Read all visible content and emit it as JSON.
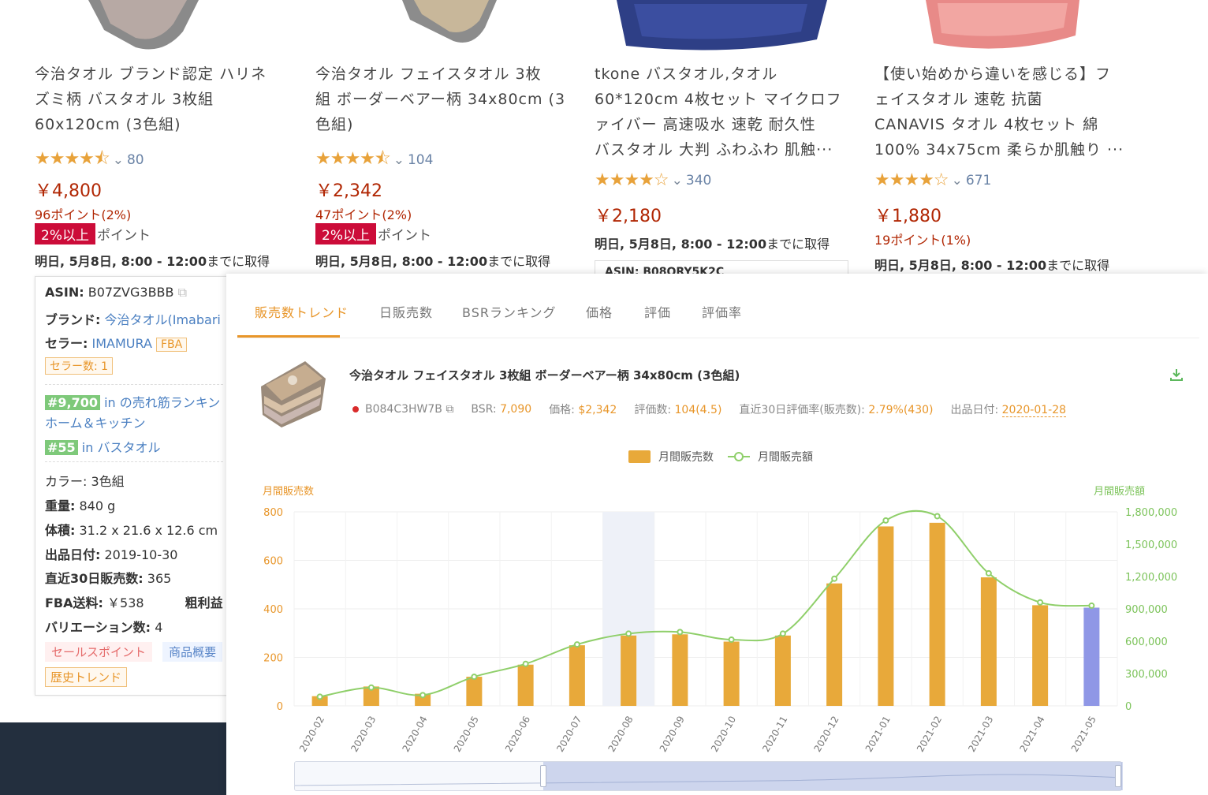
{
  "products": [
    {
      "title_lines": [
        "今治タオル ブランド認定 ハリネ",
        "ズミ柄 バスタオル 3枚組",
        "60x120cm (3色組)"
      ],
      "stars": "★★★★⯪",
      "rating_count": "80",
      "price": "￥4,800",
      "points": "96ポイント(2%)",
      "badge": "2%以上",
      "badge_suffix": "ポイント",
      "delivery_bold": "明日, 5月8日, 8:00 - 12:00",
      "delivery_rest": "までに取得"
    },
    {
      "title_lines": [
        "今治タオル フェイスタオル 3枚",
        "組 ボーダーベアー柄 34x80cm (3",
        "色組)"
      ],
      "stars": "★★★★⯪",
      "rating_count": "104",
      "price": "￥2,342",
      "points": "47ポイント(2%)",
      "badge": "2%以上",
      "badge_suffix": "ポイント",
      "delivery_bold": "明日, 5月8日, 8:00 - 12:00",
      "delivery_rest": "までに取得"
    },
    {
      "title_lines": [
        "tkone バスタオル,タオル",
        "60*120cm 4枚セット マイクロフ",
        "ァイバー 高速吸水 速乾 耐久性",
        "バスタオル 大判 ふわふわ 肌触···"
      ],
      "stars": "★★★★☆",
      "rating_count": "340",
      "price": "￥2,180",
      "delivery_bold": "明日, 5月8日, 8:00 - 12:00",
      "delivery_rest": "までに取得",
      "asin_partial": "ASIN: B08QRY5K2C"
    },
    {
      "title_lines": [
        "【使い始めから違いを感じる】フ",
        "ェイスタオル 速乾 抗菌",
        "CANAVIS タオル 4枚セット 綿",
        "100% 34x75cm 柔らか肌触り ···"
      ],
      "stars": "★★★★☆",
      "rating_count": "671",
      "price": "￥1,880",
      "points": "19ポイント(1%)",
      "delivery_bold": "明日, 5月8日, 8:00 - 12:00",
      "delivery_rest": "までに取得"
    }
  ],
  "info": {
    "asin_label": "ASIN:",
    "asin": "B07ZVG3BBB",
    "brand_label": "ブランド:",
    "brand": "今治タオル(Imabari",
    "seller_label": "セラー:",
    "seller": "IMAMURA",
    "seller_tag": "FBA",
    "seller_count": "セラー数: 1",
    "rank1": "#9,700",
    "rank1_text": "in の売れ筋ランキン",
    "rank1_cat": "ホーム＆キッチン",
    "rank2": "#55",
    "rank2_text": "in バスタオル",
    "color": "カラー: 3色組",
    "weight_label": "重量:",
    "weight": "840 g",
    "size_label": "体積:",
    "size": "31.2 x 21.6 x 12.6 cm",
    "listed_label": "出品日付:",
    "listed": "2019-10-30",
    "sales30_label": "直近30日販売数:",
    "sales30": "365",
    "fba_label": "FBA送料:",
    "fba": "￥538",
    "profit_label": "粗利益",
    "variation_label": "バリエーション数:",
    "variation": "4",
    "btn_sales_points": "セールスポイント",
    "btn_summary": "商品概要",
    "btn_history": "歴史トレンド"
  },
  "overlay": {
    "tabs": [
      "販売数トレンド",
      "日販売数",
      "BSRランキング",
      "価格",
      "評価",
      "評価率"
    ],
    "active_tab": 0,
    "product_title": "今治タオル フェイスタオル 3枚組 ボーダーベアー柄 34x80cm (3色組)",
    "asin": "B084C3HW7B",
    "bsr_label": "BSR:",
    "bsr": "7,090",
    "price_label": "価格:",
    "price": "$2,342",
    "reviews_label": "評価数:",
    "reviews": "104(4.5)",
    "rate_label": "直近30日評価率(販売数):",
    "rate": "2.79%(430)",
    "listed_label": "出品日付:",
    "listed": "2020-01-28"
  },
  "chart_data": {
    "type": "bar",
    "legend": [
      "月間販売数",
      "月間販売額"
    ],
    "left_axis_label": "月間販売数",
    "right_axis_label": "月間販売額",
    "categories": [
      "2020-02",
      "2020-03",
      "2020-04",
      "2020-05",
      "2020-06",
      "2020-07",
      "2020-08",
      "2020-09",
      "2020-10",
      "2020-11",
      "2020-12",
      "2021-01",
      "2021-02",
      "2021-03",
      "2021-04",
      "2021-05"
    ],
    "left_ticks": [
      "0",
      "200",
      "400",
      "600",
      "800"
    ],
    "right_ticks": [
      "0",
      "300,000",
      "600,000",
      "900,000",
      "1,200,000",
      "1,500,000",
      "1,800,000"
    ],
    "ylim_left": [
      0,
      800
    ],
    "ylim_right": [
      0,
      1800000
    ],
    "highlighted_category": "2020-08",
    "series": [
      {
        "name": "月間販売数",
        "type": "bar",
        "color": "#e8a93a",
        "last_color": "#8f97e6",
        "values": [
          40,
          80,
          50,
          120,
          170,
          250,
          290,
          295,
          265,
          290,
          505,
          740,
          755,
          530,
          415,
          405
        ]
      },
      {
        "name": "月間販売額",
        "type": "line",
        "color": "#8fcf6a",
        "values": [
          85000,
          170000,
          100000,
          270000,
          390000,
          570000,
          670000,
          685000,
          615000,
          670000,
          1180000,
          1720000,
          1760000,
          1230000,
          960000,
          930000
        ]
      }
    ]
  }
}
